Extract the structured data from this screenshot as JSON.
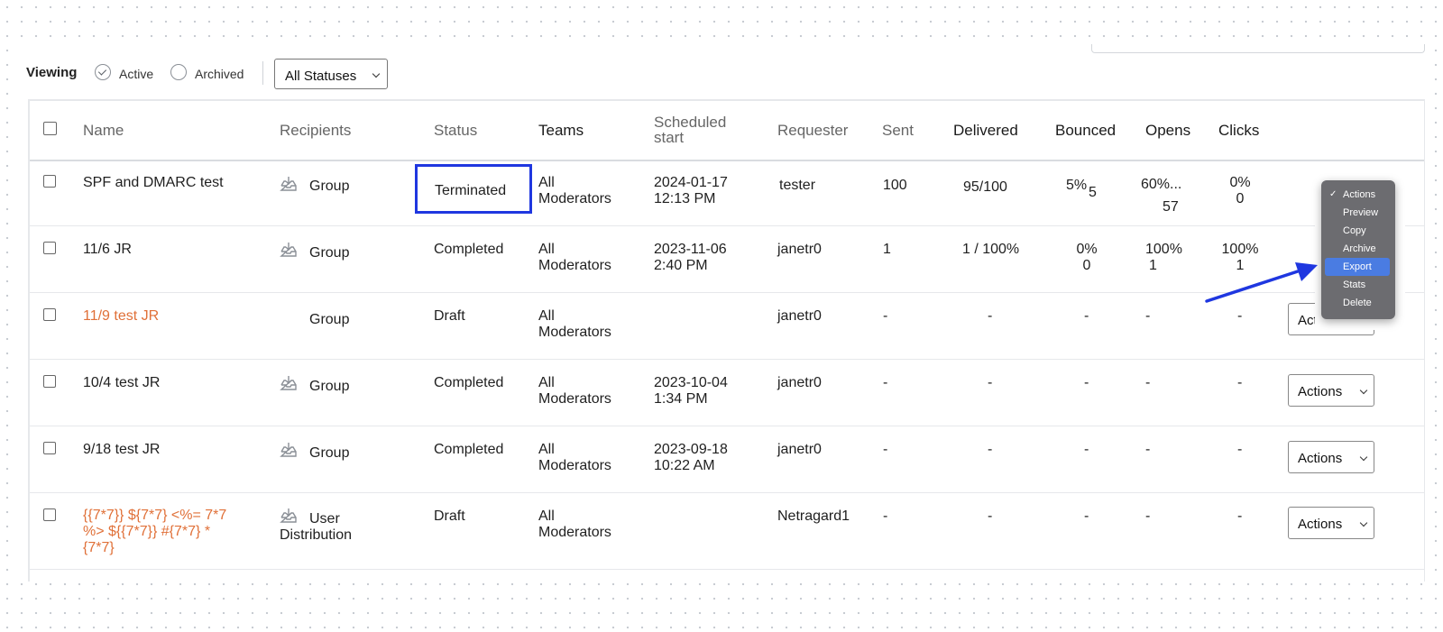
{
  "toolbar": {
    "viewing_label": "Viewing",
    "active_label": "Active",
    "archived_label": "Archived",
    "status_filter": "All Statuses"
  },
  "columns": {
    "name": "Name",
    "recipients": "Recipients",
    "status": "Status",
    "teams": "Teams",
    "scheduled_line1": "Scheduled",
    "scheduled_line2": "start",
    "requester": "Requester",
    "sent": "Sent",
    "delivered": "Delivered",
    "bounced": "Bounced",
    "opens": "Opens",
    "clicks": "Clicks"
  },
  "rows": [
    {
      "name": "SPF and DMARC test",
      "recipients": "Group",
      "status": "Terminated",
      "teams_1": "All",
      "teams_2": "Moderators",
      "date": "2024-01-17",
      "time": "12:13 PM",
      "requester": "tester",
      "sent": "100",
      "delivered": "95/100",
      "bounced_pct": "5%",
      "bounced_count": "5",
      "opens_pct": "60%...",
      "opens_count": "57",
      "clicks_pct": "0%",
      "clicks_count": "0"
    },
    {
      "name": "11/6 JR",
      "recipients": "Group",
      "status": "Completed",
      "teams_1": "All",
      "teams_2": "Moderators",
      "date": "2023-11-06",
      "time": "2:40 PM",
      "requester": "janetr0",
      "sent": "1",
      "delivered": "1 / 100%",
      "bounced_pct": "0%",
      "bounced_count": "0",
      "opens_pct": "100%",
      "opens_count": "1",
      "clicks_pct": "100%",
      "clicks_count": "1"
    },
    {
      "name": "11/9 test JR",
      "recipients": "Group",
      "status": "Draft",
      "teams_1": "All",
      "teams_2": "Moderators",
      "requester": "janetr0",
      "sent": "-",
      "delivered": "-",
      "bounced": "-",
      "opens": "-",
      "clicks": "-",
      "actions": "Actions"
    },
    {
      "name": "10/4 test JR",
      "recipients": "Group",
      "status": "Completed",
      "teams_1": "All",
      "teams_2": "Moderators",
      "date": "2023-10-04",
      "time": "1:34 PM",
      "requester": "janetr0",
      "sent": "-",
      "delivered": "-",
      "bounced": "-",
      "opens": "-",
      "clicks": "-",
      "actions": "Actions"
    },
    {
      "name": "9/18 test JR",
      "recipients": "Group",
      "status": "Completed",
      "teams_1": "All",
      "teams_2": "Moderators",
      "date": "2023-09-18",
      "time": "10:22 AM",
      "requester": "janetr0",
      "sent": "-",
      "delivered": "-",
      "bounced": "-",
      "opens": "-",
      "clicks": "-",
      "actions": "Actions"
    },
    {
      "name_1": "{{7*7}} ${7*7} <%= 7*7",
      "name_2": "%> ${{7*7}} #{7*7} *",
      "name_3": "{7*7}",
      "recipients_1": "User",
      "recipients_2": "Distribution",
      "status": "Draft",
      "teams_1": "All",
      "teams_2": "Moderators",
      "requester": "Netragard1",
      "sent": "-",
      "delivered": "-",
      "bounced": "-",
      "opens": "-",
      "clicks": "-",
      "actions": "Actions"
    }
  ],
  "actions_menu": {
    "items": [
      "Actions",
      "Preview",
      "Copy",
      "Archive",
      "Export",
      "Stats",
      "Delete"
    ],
    "selected": "Actions",
    "highlighted": "Export"
  },
  "colors": {
    "highlight_box": "#1f37e0",
    "arrow": "#1f37e0",
    "draft_name": "#e07038",
    "menu_highlight": "#4a7ce2"
  }
}
